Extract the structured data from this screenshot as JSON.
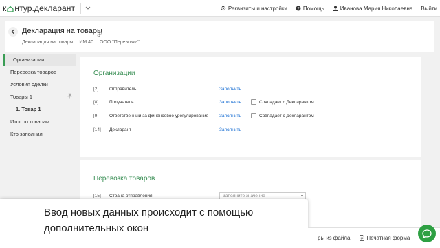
{
  "topbar": {
    "logo_left": "к",
    "logo_right": "нтур.декларант",
    "settings_label": "Реквизиты и настройки",
    "help_label": "Помощь",
    "user_name": "Иванова Мария Николаевна",
    "logout_label": "Выйти"
  },
  "header": {
    "title": "Декларация на товары",
    "meta": [
      "Декларация на товары",
      "ИМ 40",
      "ООО \"Перевозка\""
    ]
  },
  "sidebar": {
    "items": [
      {
        "label": "Организации"
      },
      {
        "label": "Перевозка товаров"
      },
      {
        "label": "Условия сделки"
      },
      {
        "label": "Товары 1"
      },
      {
        "label": "1. Товар 1"
      },
      {
        "label": "Итог по товарам"
      },
      {
        "label": "Кто заполнил"
      }
    ]
  },
  "organizations": {
    "title": "Организации",
    "rows": [
      {
        "num": "[2]",
        "label": "Отправитель",
        "action": "Заполнить"
      },
      {
        "num": "[8]",
        "label": "Получатель",
        "action": "Заполнить",
        "checkbox": "Совпадает с Декларантом"
      },
      {
        "num": "[9]",
        "label": "Ответственный за финансовое урегулирование",
        "action": "Заполнить",
        "checkbox": "Совпадает с Декларантом"
      },
      {
        "num": "[14]",
        "label": "Декларант",
        "action": "Заполнить"
      }
    ]
  },
  "transport": {
    "title": "Перевозка товаров",
    "row": {
      "num": "[15]",
      "label": "Страна отправления",
      "placeholder": "Заполните значение"
    }
  },
  "overlay": {
    "text": "Ввод новых данных происходит с помощью дополнительных окон"
  },
  "bottombar": {
    "import_label": "ры из файла",
    "print_label": "Печатная форма",
    "more": "⋮"
  },
  "colors": {
    "accent_green": "#3a9d55",
    "link_blue": "#1a6fd3",
    "chat_green": "#2ea043"
  }
}
